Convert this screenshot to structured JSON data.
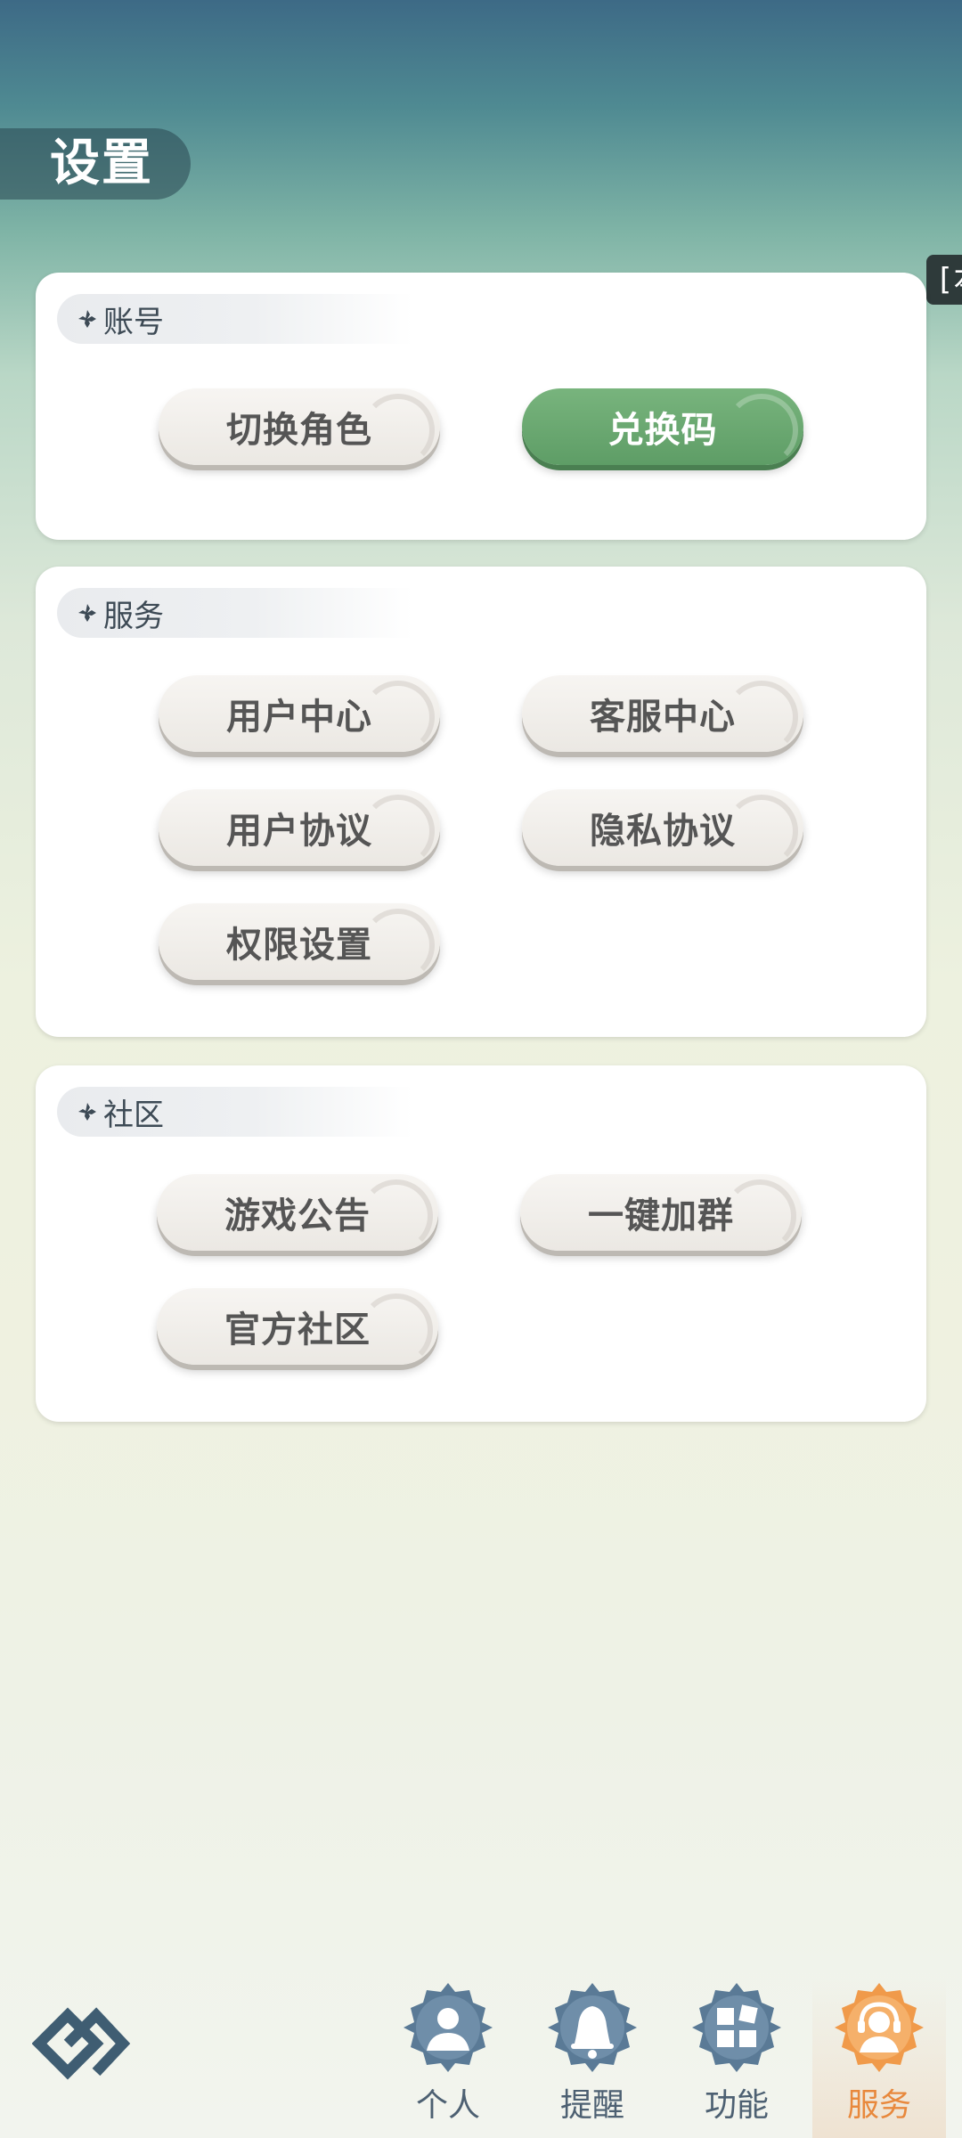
{
  "header": {
    "title": "设置",
    "edge_tab_text": "[本"
  },
  "sections": {
    "account": {
      "title": "账号",
      "buttons": {
        "switch_role": "切换角色",
        "redeem_code": "兑换码"
      }
    },
    "service": {
      "title": "服务",
      "buttons": {
        "user_center": "用户中心",
        "customer_service": "客服中心",
        "user_agreement": "用户协议",
        "privacy_agreement": "隐私协议",
        "permission_settings": "权限设置"
      }
    },
    "community": {
      "title": "社区",
      "buttons": {
        "game_announcement": "游戏公告",
        "join_group": "一键加群",
        "official_community": "官方社区"
      }
    }
  },
  "bottom_nav": {
    "items": [
      {
        "label": "个人",
        "icon": "person-icon"
      },
      {
        "label": "提醒",
        "icon": "bell-icon"
      },
      {
        "label": "功能",
        "icon": "grid-icon"
      },
      {
        "label": "服务",
        "icon": "headset-icon"
      }
    ],
    "active": "服务"
  },
  "colors": {
    "accent_green": "#68a86f",
    "active_orange": "#e8883c",
    "nav_icon_blue": "#5a7a96"
  }
}
